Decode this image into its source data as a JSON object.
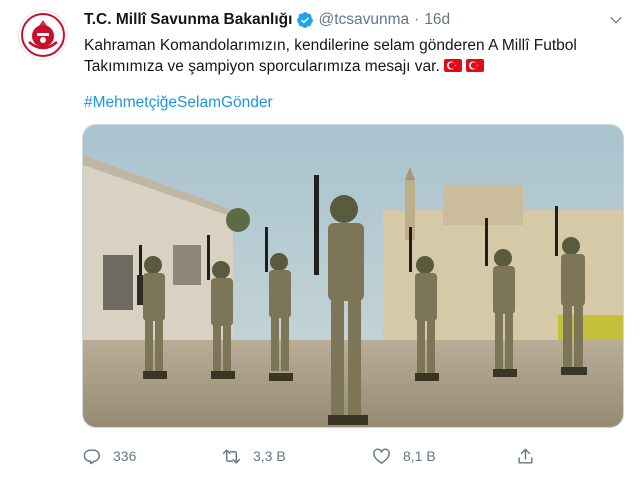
{
  "author": {
    "name": "T.C. Millî Savunma Bakanlığı",
    "handle": "@tcsavunma",
    "separator": "·",
    "time": "16d"
  },
  "tweet": {
    "line1": "Kahraman Komandolarımızın, kendilerine selam gönderen A Millî Futbol",
    "line2": "Takımımıza ve şampiyon sporcularımıza mesajı var.",
    "hashtag": "#MehmetçiğeSelamGönder"
  },
  "media": {
    "kind": "video-thumbnail",
    "description_icons": [
      "soldier-group"
    ]
  },
  "actions": {
    "reply_count": "336",
    "retweet_count": "3,3 B",
    "like_count": "8,1 B"
  },
  "icons": [
    "ministry-logo-icon",
    "verified-badge-icon",
    "chevron-down-icon",
    "turkish-flag-icon",
    "reply-icon",
    "retweet-icon",
    "like-icon",
    "share-icon"
  ],
  "colors": {
    "text": "#14171a",
    "secondary": "#657786",
    "link": "#1b95e0",
    "flag_red": "#e30a17"
  }
}
